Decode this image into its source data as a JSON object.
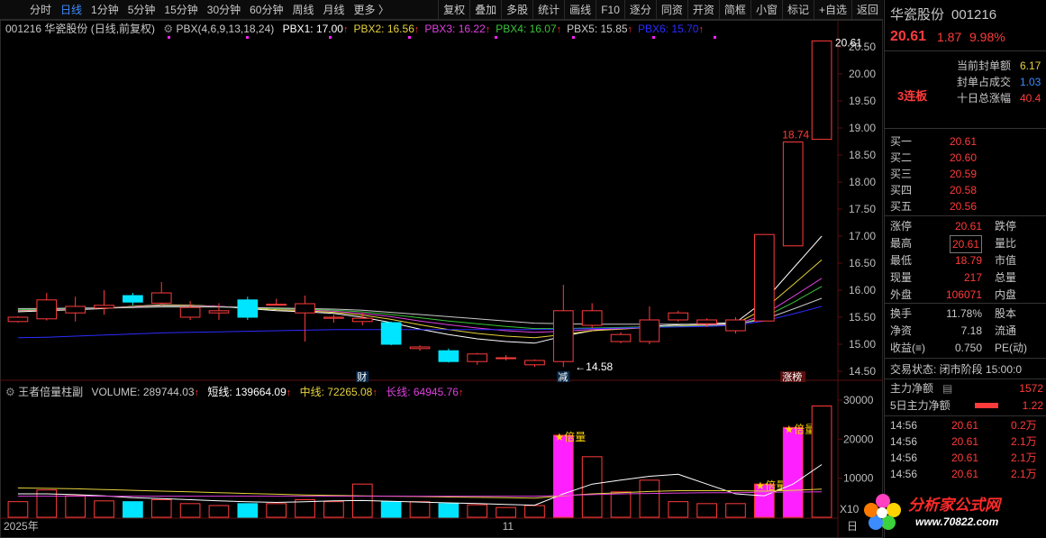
{
  "toolbar": {
    "periods": [
      "分时",
      "日线",
      "1分钟",
      "5分钟",
      "15分钟",
      "30分钟",
      "60分钟",
      "周线",
      "月线",
      "更多 〉"
    ],
    "active_period": "日线",
    "tools": [
      "复权",
      "叠加",
      "多股",
      "统计",
      "画线",
      "F10",
      "逐分",
      "同资",
      "开资",
      "简框",
      "小窗",
      "标记",
      "+自选",
      "返回"
    ]
  },
  "kline": {
    "title": "001216 华瓷股份 (日线,前复权)",
    "indicator": "PBX(4,6,9,13,18,24)",
    "pbx": [
      {
        "label": "PBX1:",
        "value": "17.00",
        "color": "#ffffff"
      },
      {
        "label": "PBX2:",
        "value": "16.56",
        "color": "#e6d23c"
      },
      {
        "label": "PBX3:",
        "value": "16.22",
        "color": "#e040e0"
      },
      {
        "label": "PBX4:",
        "value": "16.07",
        "color": "#39c43a"
      },
      {
        "label": "PBX5:",
        "value": "15.85",
        "color": "#c8c8c8"
      },
      {
        "label": "PBX6:",
        "value": "15.70",
        "color": "#2b2bff"
      }
    ],
    "yticks": [
      "20.50",
      "20.00",
      "19.50",
      "19.00",
      "18.50",
      "18.00",
      "17.50",
      "17.00",
      "16.50",
      "16.00",
      "15.50",
      "15.00",
      "14.50"
    ],
    "high_label": "20.61",
    "mid_label": "18.74",
    "low_label": "14.58",
    "markers": [
      {
        "text": "财",
        "color": "#ffffff"
      },
      {
        "text": "减",
        "color": "#ffffff"
      },
      {
        "text": "涨榜",
        "color": "#ffffff"
      }
    ]
  },
  "volume": {
    "title": "王者倍量柱副",
    "volume": "VOLUME: 289744.03",
    "short": "短线: 139664.09",
    "mid": "中线: 72265.08",
    "long": "长线: 64945.76",
    "yticks": [
      "30000",
      "20000",
      "10000"
    ],
    "unit": "X10",
    "tag": "倍量",
    "xlabels": [
      "2025年",
      "11",
      "日"
    ]
  },
  "chart_data": {
    "type": "candlestick",
    "candles": [
      {
        "o": 15.42,
        "c": 15.5,
        "h": 15.52,
        "l": 15.4,
        "v": 4000
      },
      {
        "o": 15.47,
        "c": 15.82,
        "h": 15.95,
        "l": 15.44,
        "v": 7000
      },
      {
        "o": 15.58,
        "c": 15.7,
        "h": 15.88,
        "l": 15.42,
        "v": 5500
      },
      {
        "o": 15.67,
        "c": 15.72,
        "h": 16.0,
        "l": 15.55,
        "v": 4200
      },
      {
        "o": 15.9,
        "c": 15.78,
        "h": 15.95,
        "l": 15.72,
        "v": 4000
      },
      {
        "o": 15.76,
        "c": 15.95,
        "h": 16.15,
        "l": 15.7,
        "v": 4500
      },
      {
        "o": 15.5,
        "c": 15.68,
        "h": 15.8,
        "l": 15.45,
        "v": 3500
      },
      {
        "o": 15.58,
        "c": 15.62,
        "h": 15.76,
        "l": 15.45,
        "v": 3000
      },
      {
        "o": 15.82,
        "c": 15.5,
        "h": 15.88,
        "l": 15.45,
        "v": 3500
      },
      {
        "o": 15.74,
        "c": 15.74,
        "h": 15.84,
        "l": 15.72,
        "v": 3500
      },
      {
        "o": 15.58,
        "c": 15.75,
        "h": 15.9,
        "l": 15.05,
        "v": 4500
      },
      {
        "o": 15.48,
        "c": 15.5,
        "h": 15.55,
        "l": 15.4,
        "v": 4000
      },
      {
        "o": 15.42,
        "c": 15.48,
        "h": 15.58,
        "l": 15.35,
        "v": 8500
      },
      {
        "o": 15.4,
        "c": 15.0,
        "h": 15.42,
        "l": 14.98,
        "v": 4000
      },
      {
        "o": 14.92,
        "c": 14.95,
        "h": 14.98,
        "l": 14.88,
        "v": 4000
      },
      {
        "o": 14.88,
        "c": 14.68,
        "h": 14.92,
        "l": 14.66,
        "v": 3500
      },
      {
        "o": 14.68,
        "c": 14.82,
        "h": 14.84,
        "l": 14.62,
        "v": 3200
      },
      {
        "o": 14.75,
        "c": 14.75,
        "h": 14.8,
        "l": 14.7,
        "v": 2500
      },
      {
        "o": 14.62,
        "c": 14.7,
        "h": 14.72,
        "l": 14.58,
        "v": 3000
      },
      {
        "o": 14.68,
        "c": 15.62,
        "h": 16.1,
        "l": 14.58,
        "v": 21000
      },
      {
        "o": 15.35,
        "c": 15.62,
        "h": 15.76,
        "l": 15.3,
        "v": 15500
      },
      {
        "o": 15.05,
        "c": 15.18,
        "h": 15.22,
        "l": 15.02,
        "v": 6500
      },
      {
        "o": 15.05,
        "c": 15.45,
        "h": 15.7,
        "l": 15.0,
        "v": 9500
      },
      {
        "o": 15.45,
        "c": 15.58,
        "h": 15.62,
        "l": 15.42,
        "v": 4000
      },
      {
        "o": 15.38,
        "c": 15.45,
        "h": 15.48,
        "l": 15.32,
        "v": 3500
      },
      {
        "o": 15.25,
        "c": 15.45,
        "h": 15.5,
        "l": 15.2,
        "v": 3500
      },
      {
        "o": 15.43,
        "c": 17.03,
        "h": 17.03,
        "l": 15.43,
        "v": 8500
      },
      {
        "o": 16.82,
        "c": 18.74,
        "h": 18.74,
        "l": 16.82,
        "v": 23000
      },
      {
        "o": 18.79,
        "c": 20.61,
        "h": 20.61,
        "l": 18.79,
        "v": 28500
      }
    ],
    "ma_lines": [
      {
        "name": "PBX1",
        "color": "#ffffff",
        "values": [
          15.6,
          15.62,
          15.64,
          15.66,
          15.7,
          15.73,
          15.72,
          15.7,
          15.66,
          15.62,
          15.6,
          15.57,
          15.5,
          15.4,
          15.28,
          15.18,
          15.1,
          15.05,
          15.02,
          15.15,
          15.25,
          15.3,
          15.33,
          15.36,
          15.38,
          15.4,
          15.8,
          16.4,
          17.0
        ]
      },
      {
        "name": "PBX2",
        "color": "#e6d23c",
        "values": [
          15.62,
          15.63,
          15.65,
          15.67,
          15.7,
          15.72,
          15.72,
          15.7,
          15.67,
          15.64,
          15.62,
          15.59,
          15.54,
          15.46,
          15.36,
          15.27,
          15.2,
          15.15,
          15.12,
          15.18,
          15.25,
          15.28,
          15.31,
          15.34,
          15.36,
          15.38,
          15.65,
          16.1,
          16.56
        ]
      },
      {
        "name": "PBX3",
        "color": "#e040e0",
        "values": [
          15.63,
          15.64,
          15.65,
          15.67,
          15.69,
          15.71,
          15.71,
          15.7,
          15.68,
          15.66,
          15.64,
          15.61,
          15.57,
          15.51,
          15.43,
          15.36,
          15.3,
          15.25,
          15.22,
          15.24,
          15.27,
          15.29,
          15.31,
          15.33,
          15.35,
          15.36,
          15.55,
          15.88,
          16.22
        ]
      },
      {
        "name": "PBX4",
        "color": "#39c43a",
        "values": [
          15.64,
          15.65,
          15.66,
          15.67,
          15.68,
          15.7,
          15.7,
          15.69,
          15.68,
          15.66,
          15.65,
          15.63,
          15.6,
          15.55,
          15.49,
          15.43,
          15.38,
          15.33,
          15.29,
          15.29,
          15.3,
          15.31,
          15.32,
          15.33,
          15.34,
          15.35,
          15.5,
          15.77,
          16.07
        ]
      },
      {
        "name": "PBX5",
        "color": "#c8c8c8",
        "values": [
          15.66,
          15.66,
          15.67,
          15.67,
          15.68,
          15.69,
          15.69,
          15.69,
          15.68,
          15.67,
          15.66,
          15.65,
          15.63,
          15.59,
          15.55,
          15.51,
          15.47,
          15.43,
          15.39,
          15.38,
          15.37,
          15.37,
          15.37,
          15.37,
          15.37,
          15.37,
          15.46,
          15.65,
          15.85
        ]
      },
      {
        "name": "PBX6",
        "color": "#2b2bff",
        "values": [
          15.12,
          15.13,
          15.15,
          15.17,
          15.19,
          15.21,
          15.22,
          15.23,
          15.24,
          15.25,
          15.26,
          15.27,
          15.27,
          15.27,
          15.27,
          15.27,
          15.27,
          15.27,
          15.27,
          15.28,
          15.29,
          15.3,
          15.31,
          15.32,
          15.33,
          15.35,
          15.43,
          15.56,
          15.7
        ]
      }
    ],
    "volume_lines": [
      {
        "name": "短线",
        "color": "#ffffff",
        "values": [
          6000,
          6000,
          5800,
          5500,
          5000,
          4800,
          4500,
          4200,
          4000,
          3800,
          4000,
          4200,
          4300,
          4100,
          3900,
          3700,
          3500,
          3300,
          3100,
          6000,
          8500,
          9500,
          10500,
          11000,
          8500,
          6000,
          5500,
          8500,
          13500
        ]
      },
      {
        "name": "中线",
        "color": "#e6d23c",
        "values": [
          7500,
          7400,
          7300,
          7100,
          6900,
          6700,
          6500,
          6300,
          6100,
          5900,
          5700,
          5600,
          5500,
          5400,
          5300,
          5200,
          5100,
          5000,
          4900,
          5500,
          6000,
          6300,
          6600,
          6800,
          6800,
          6800,
          6700,
          6900,
          7200
        ]
      },
      {
        "name": "长线",
        "color": "#e040e0",
        "values": [
          5400,
          5400,
          5400,
          5400,
          5400,
          5400,
          5400,
          5400,
          5400,
          5400,
          5400,
          5400,
          5400,
          5400,
          5400,
          5400,
          5400,
          5400,
          5400,
          5600,
          5800,
          6000,
          6100,
          6200,
          6300,
          6300,
          6400,
          6450,
          6500
        ]
      }
    ],
    "double_volume_bars": [
      19,
      26,
      27
    ]
  },
  "panel": {
    "name": "华瓷股份",
    "code": "001216",
    "price": "20.61",
    "change": "1.87",
    "pct": "9.98%",
    "board_label": "3连板",
    "seal_rows": [
      {
        "label": "当前封单额",
        "value": "6.17",
        "color": "#e6d23c"
      },
      {
        "label": "封单占成交",
        "value": "1.03",
        "color": "#3c8cff"
      },
      {
        "label": "十日总涨幅",
        "value": "40.4",
        "color": "#ff3b3b"
      }
    ],
    "bids": [
      {
        "label": "买一",
        "value": "20.61"
      },
      {
        "label": "买二",
        "value": "20.60"
      },
      {
        "label": "买三",
        "value": "20.59"
      },
      {
        "label": "买四",
        "value": "20.58"
      },
      {
        "label": "买五",
        "value": "20.56"
      }
    ],
    "quote_rows": [
      {
        "label": "涨停",
        "value": "20.61",
        "label2": "跌停"
      },
      {
        "label": "最高",
        "value": "20.61",
        "label2": "量比"
      },
      {
        "label": "最低",
        "value": "18.79",
        "label2": "市值"
      },
      {
        "label": "现量",
        "value": "217",
        "label2": "总量"
      },
      {
        "label": "外盘",
        "value": "106071",
        "label2": "内盘"
      }
    ],
    "stat_rows": [
      {
        "label": "换手",
        "value": "11.78%",
        "label2": "股本"
      },
      {
        "label": "净资",
        "value": "7.18",
        "label2": "流通"
      },
      {
        "label": "收益(≡)",
        "value": "0.750",
        "label2": "PE(动)"
      }
    ],
    "trade_status": "交易状态: 闭市阶段 15:00:0",
    "main_flow_label": "主力净额",
    "main_flow_value": "1572",
    "main_flow5_label": "5日主力净额",
    "main_flow5_value": "1.22",
    "ticks": [
      {
        "time": "14:56",
        "price": "20.61",
        "vol": "0.2万"
      },
      {
        "time": "14:56",
        "price": "20.61",
        "vol": "2.1万"
      },
      {
        "time": "14:56",
        "price": "20.61",
        "vol": "2.1万"
      },
      {
        "time": "14:56",
        "price": "20.61",
        "vol": "2.1万"
      }
    ]
  },
  "watermark": {
    "text": "分析家公式网",
    "url": "www.70822.com"
  }
}
